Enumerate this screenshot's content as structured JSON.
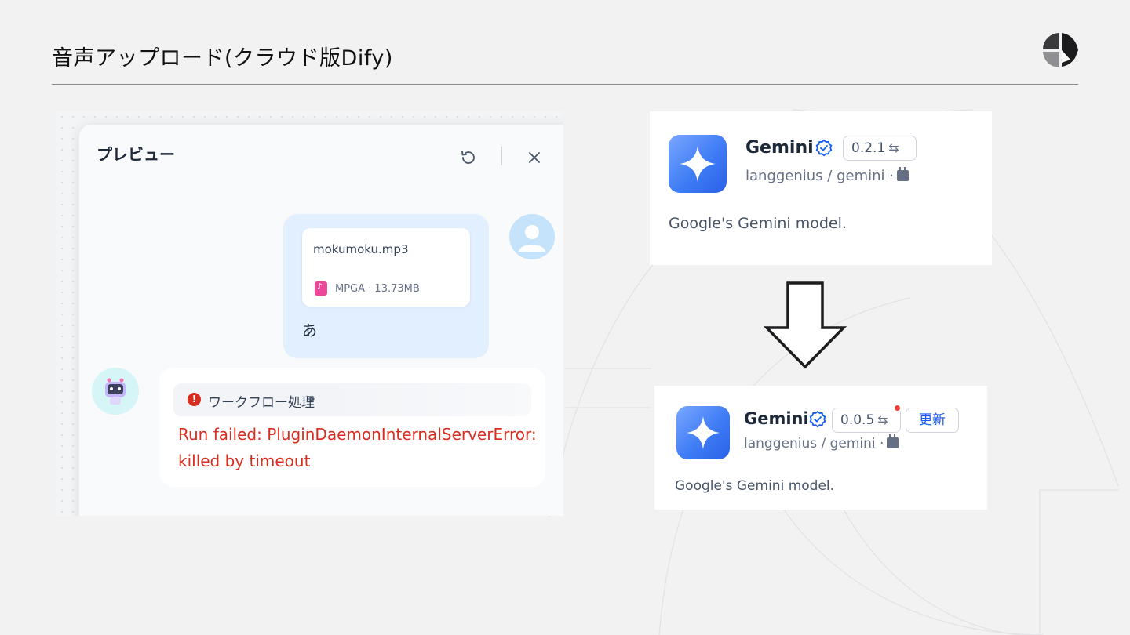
{
  "slide": {
    "title": "音声アップロード(クラウド版Dify)"
  },
  "preview": {
    "title": "プレビュー",
    "reset_icon": "refresh-icon",
    "close_icon": "close-icon",
    "user_message": {
      "file_name": "mokumoku.mp3",
      "file_meta": "MPGA · 13.73MB",
      "text": "あ"
    },
    "bot_message": {
      "workflow_label": "ワークフロー処理",
      "workflow_chevron": ">",
      "error_text": "Run failed: PluginDaemonInternalServerError: killed by timeout"
    },
    "colors": {
      "user_bubble": "#e1effe",
      "error": "#d92d20"
    }
  },
  "plugin_before": {
    "name": "Gemini",
    "version": "0.2.1",
    "swap_icon": "⇆",
    "org_path": "langgenius / gemini ·",
    "description": "Google's Gemini model."
  },
  "plugin_after": {
    "name": "Gemini",
    "version": "0.0.5",
    "swap_icon": "⇆",
    "update_label": "更新",
    "org_path": "langgenius / gemini ·",
    "description": "Google's Gemini model."
  }
}
